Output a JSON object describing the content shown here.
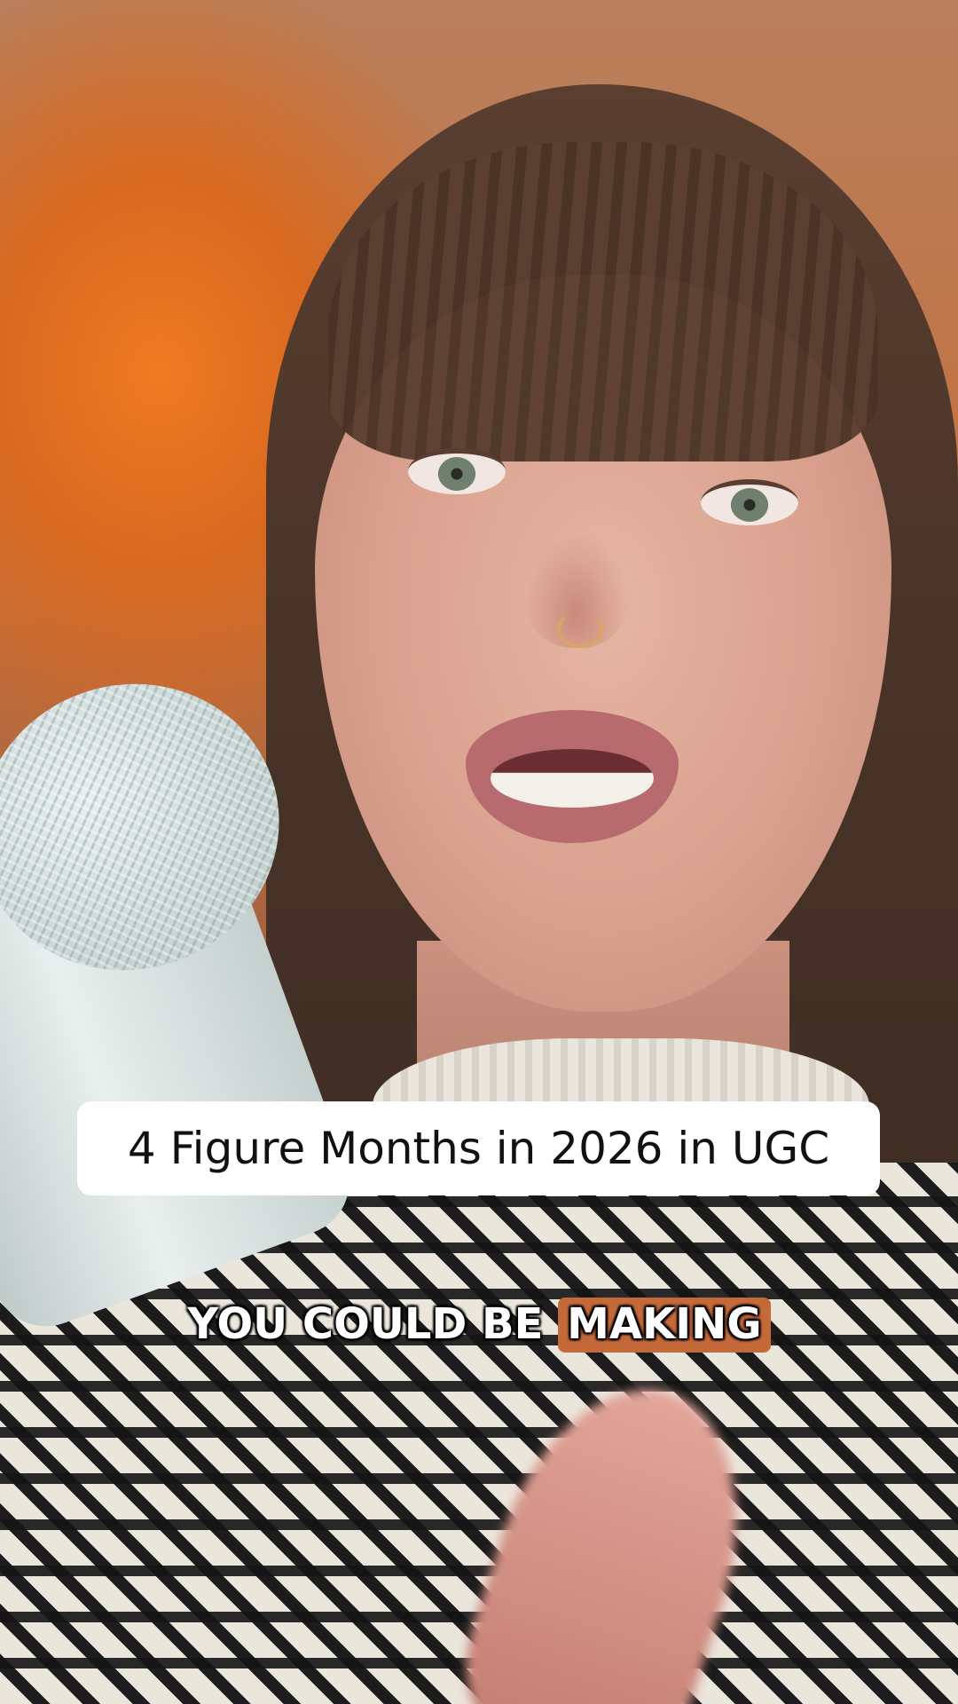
{
  "overlay": {
    "title": "4 Figure Months in 2026 in UGC",
    "caption_words": [
      "YOU",
      "COULD",
      "BE",
      "MAKING"
    ],
    "caption_plain": "YOU COULD BE",
    "caption_highlight": "MAKING",
    "highlight_color": "#c4693a"
  }
}
